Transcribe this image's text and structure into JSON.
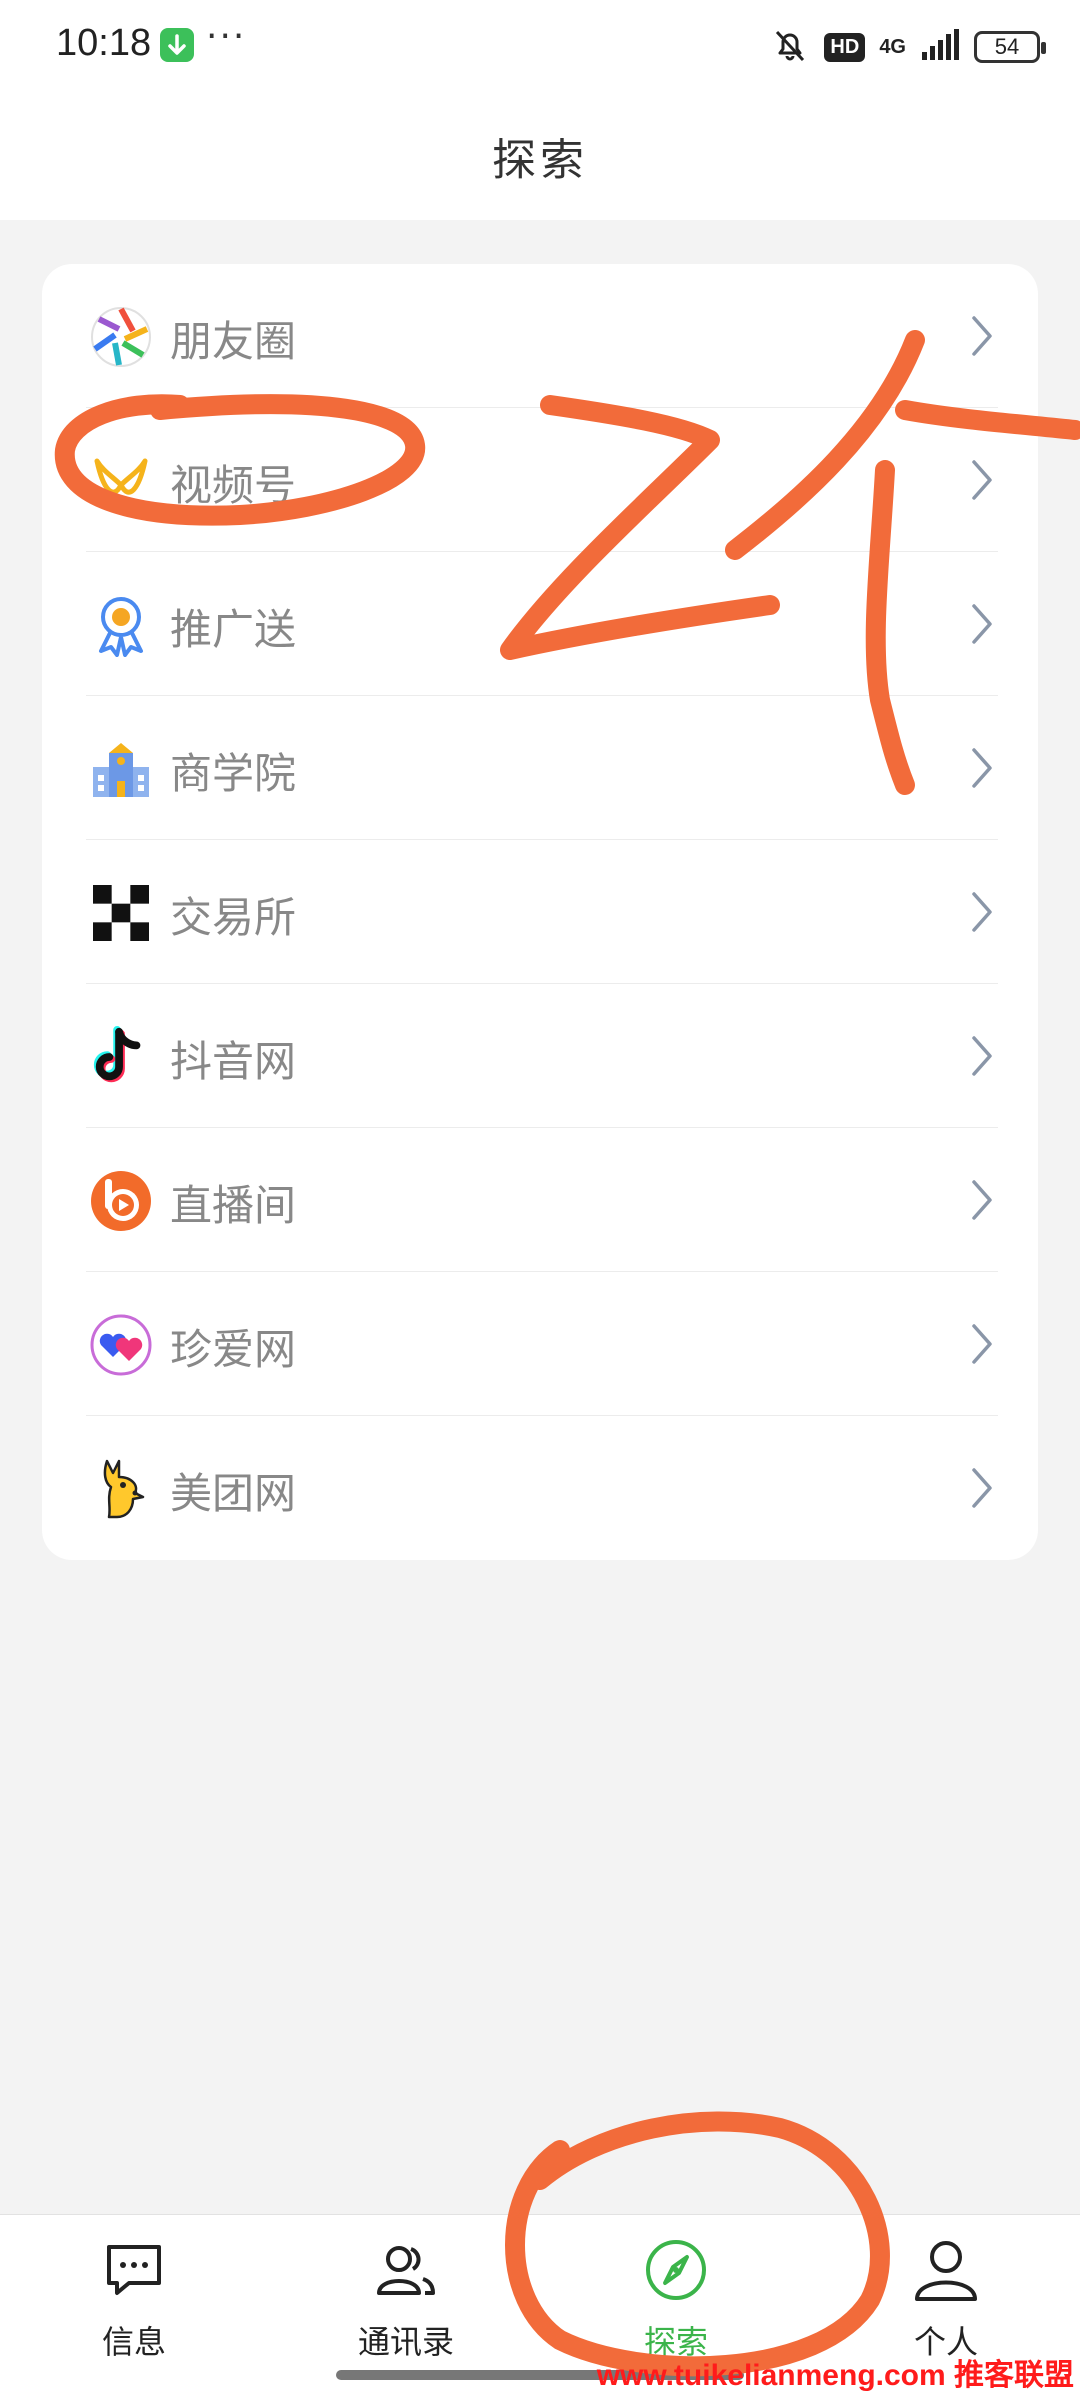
{
  "status_bar": {
    "time": "10:18",
    "network": "4G",
    "hd": "HD",
    "battery": "54"
  },
  "header": {
    "title": "探索"
  },
  "menu": {
    "items": [
      {
        "label": "朋友圈",
        "icon": "aperture-icon"
      },
      {
        "label": "视频号",
        "icon": "channels-icon"
      },
      {
        "label": "推广送",
        "icon": "award-ribbon-icon"
      },
      {
        "label": "商学院",
        "icon": "school-building-icon"
      },
      {
        "label": "交易所",
        "icon": "checker-exchange-icon"
      },
      {
        "label": "抖音网",
        "icon": "tiktok-note-icon"
      },
      {
        "label": "直播间",
        "icon": "live-play-icon"
      },
      {
        "label": "珍爱网",
        "icon": "hearts-icon"
      },
      {
        "label": "美团网",
        "icon": "kangaroo-icon"
      }
    ]
  },
  "tabbar": {
    "tabs": [
      {
        "label": "信息",
        "icon": "chat-bubble-icon"
      },
      {
        "label": "通讯录",
        "icon": "contacts-icon"
      },
      {
        "label": "探索",
        "icon": "compass-icon",
        "active": true
      },
      {
        "label": "个人",
        "icon": "person-icon"
      }
    ]
  },
  "annotation": {
    "handwritten_text": "24",
    "color": "#f26b3a"
  },
  "watermark": "www.tuikelianmeng.com 推客联盟",
  "colors": {
    "accent_green": "#3bb44a",
    "annotation_orange": "#f26b3a",
    "watermark_red": "#ff1b1b"
  }
}
